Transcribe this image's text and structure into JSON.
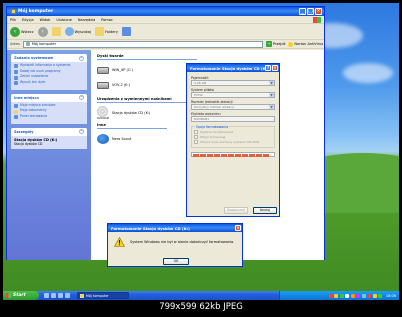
{
  "colors": {
    "xp_blue": "#0a58e6",
    "taskbar": "#245edb",
    "start_green": "#3aa53a",
    "tray": "#0c74d6",
    "warn_yellow": "#f6d21a"
  },
  "window": {
    "title": "Mój komputer",
    "menu": [
      "Plik",
      "Edycja",
      "Widok",
      "Ulubione",
      "Narzędzia",
      "Pomoc"
    ],
    "toolbar": {
      "back": "Wstecz",
      "search": "Wyszukaj",
      "folders": "Foldery"
    },
    "address": {
      "label": "Adres",
      "value": "Mój komputer",
      "go": "Przejdź",
      "norton": "Norton AntiVirus"
    }
  },
  "sidebar": {
    "system_tasks": {
      "title": "Zadania systemowe",
      "items": [
        "Wyświetl informacje o systemie",
        "Dodaj lub usuń programy",
        "Zmień ustawienie",
        "Wysuń ten dysk"
      ]
    },
    "other_places": {
      "title": "Inne miejsca",
      "items": [
        "Moje miejsca sieciowe",
        "Moje dokumenty",
        "Panel sterowania"
      ]
    },
    "details": {
      "title": "Szczegóły",
      "name": "Stacja dysków CD (K:)",
      "type": "Stacja dysków CD"
    }
  },
  "content": {
    "hard_drives_title": "Dyski twarde",
    "drives": [
      "WIN_XP (C:)",
      "VOV-2 (E:)"
    ],
    "removable_title": "Urządzenia z wymiennymi nośnikami",
    "removable": [
      "Stacja dysków CD (K:)"
    ],
    "removable_label": "DVD-RAM",
    "other_title": "Inne",
    "other": [
      "Nero Scout"
    ]
  },
  "format_dialog": {
    "title": "Formatowanie Stacja dysków CD (K:)",
    "capacity_label": "Pojemność:",
    "capacity_value": "4,26 GB",
    "fs_label": "System plików",
    "fs_value": "FAT32",
    "unit_label": "Rozmiar jednostki alokacji",
    "unit_value": "Domyślny rozmiar alokacji",
    "volume_label": "Etykieta woluminu",
    "volume_value": "DVDRAM1",
    "options_label": "Opcje formatowania",
    "options": [
      "Szybkie formatowanie",
      "Włącz kompresję",
      "Utwórz dysk startowy systemu MS-DOS"
    ],
    "progress_fraction": 1.0,
    "start_button": "Rozpocznij",
    "close_button": "Anuluj"
  },
  "message_box": {
    "title": "Formatowanie Stacja dysków CD (K:)",
    "text": "System Windows nie był w stanie dokończyć formatowania.",
    "ok": "OK"
  },
  "taskbar": {
    "start": "Start",
    "task": "Mój komputer",
    "clock": "18:06"
  },
  "caption": "799x599  62kb  JPEG"
}
